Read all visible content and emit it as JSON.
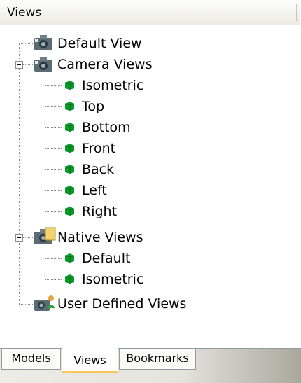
{
  "panel": {
    "header": "Views"
  },
  "tree": {
    "default_view": "Default View",
    "camera_views": {
      "label": "Camera Views",
      "children": [
        "Isometric",
        "Top",
        "Bottom",
        "Front",
        "Back",
        "Left",
        "Right"
      ]
    },
    "native_views": {
      "label": "Native Views",
      "children": [
        "Default",
        "Isometric"
      ]
    },
    "user_defined_views": "User Defined Views"
  },
  "tabs": [
    {
      "label": "Models"
    },
    {
      "label": "Views"
    },
    {
      "label": "Bookmarks"
    }
  ],
  "colors": {
    "cube_green": "#0a9a2a",
    "tab_active_underline": "#f6c65a",
    "camera_body": "#5a6a72"
  }
}
